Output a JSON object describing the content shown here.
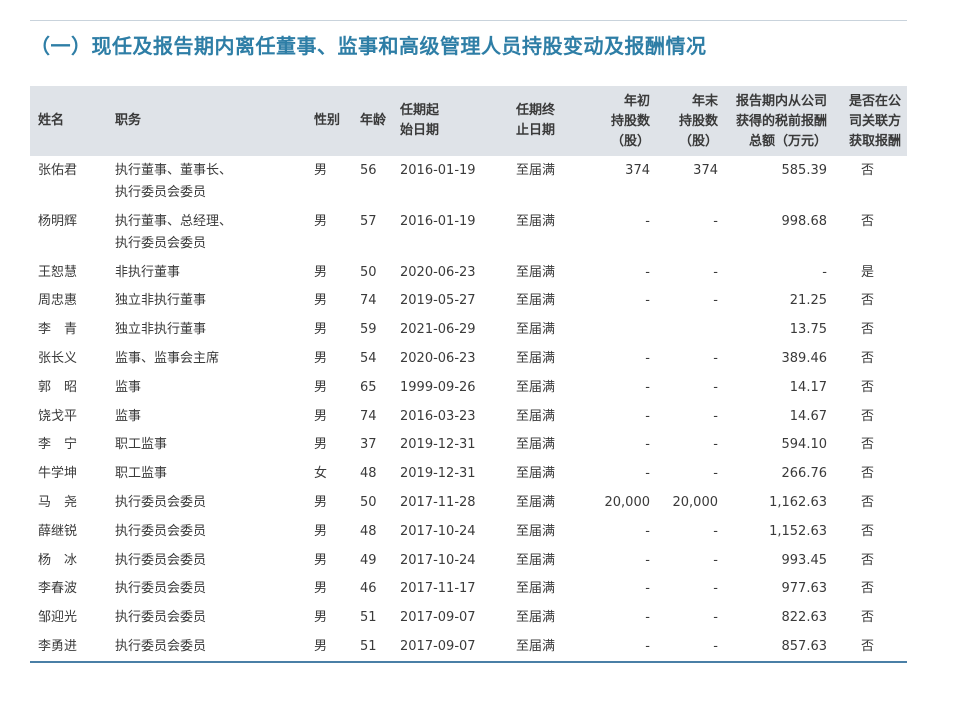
{
  "title": "（一）现任及报告期内离任董事、监事和高级管理人员持股变动及报酬情况",
  "headers": {
    "name": "姓名",
    "position": "职务",
    "gender": "性别",
    "age": "年龄",
    "start": [
      "任期起",
      "始日期"
    ],
    "end": [
      "任期终",
      "止日期"
    ],
    "begin_shares": [
      "年初",
      "持股数",
      "（股）"
    ],
    "end_shares": [
      "年末",
      "持股数",
      "（股）"
    ],
    "pay": [
      "报告期内从公司",
      "获得的税前报酬",
      "总额（万元）"
    ],
    "related": [
      "是否在公",
      "司关联方",
      "获取报酬"
    ]
  },
  "rows": [
    {
      "name": "张佑君",
      "position": [
        "执行董事、董事长、",
        "执行委员会委员"
      ],
      "gender": "男",
      "age": "56",
      "start": "2016-01-19",
      "end": "至届满",
      "begin_shares": "374",
      "end_shares": "374",
      "pay": "585.39",
      "related": "否"
    },
    {
      "name": "杨明辉",
      "position": [
        "执行董事、总经理、",
        "执行委员会委员"
      ],
      "gender": "男",
      "age": "57",
      "start": "2016-01-19",
      "end": "至届满",
      "begin_shares": "-",
      "end_shares": "-",
      "pay": "998.68",
      "related": "否"
    },
    {
      "name": "王恕慧",
      "position": [
        "非执行董事"
      ],
      "gender": "男",
      "age": "50",
      "start": "2020-06-23",
      "end": "至届满",
      "begin_shares": "-",
      "end_shares": "-",
      "pay": "-",
      "related": "是"
    },
    {
      "name": "周忠惠",
      "position": [
        "独立非执行董事"
      ],
      "gender": "男",
      "age": "74",
      "start": "2019-05-27",
      "end": "至届满",
      "begin_shares": "-",
      "end_shares": "-",
      "pay": "21.25",
      "related": "否"
    },
    {
      "name": "李　青",
      "position": [
        "独立非执行董事"
      ],
      "gender": "男",
      "age": "59",
      "start": "2021-06-29",
      "end": "至届满",
      "begin_shares": "",
      "end_shares": "",
      "pay": "13.75",
      "related": "否"
    },
    {
      "name": "张长义",
      "position": [
        "监事、监事会主席"
      ],
      "gender": "男",
      "age": "54",
      "start": "2020-06-23",
      "end": "至届满",
      "begin_shares": "-",
      "end_shares": "-",
      "pay": "389.46",
      "related": "否"
    },
    {
      "name": "郭　昭",
      "position": [
        "监事"
      ],
      "gender": "男",
      "age": "65",
      "start": "1999-09-26",
      "end": "至届满",
      "begin_shares": "-",
      "end_shares": "-",
      "pay": "14.17",
      "related": "否"
    },
    {
      "name": "饶戈平",
      "position": [
        "监事"
      ],
      "gender": "男",
      "age": "74",
      "start": "2016-03-23",
      "end": "至届满",
      "begin_shares": "-",
      "end_shares": "-",
      "pay": "14.67",
      "related": "否"
    },
    {
      "name": "李　宁",
      "position": [
        "职工监事"
      ],
      "gender": "男",
      "age": "37",
      "start": "2019-12-31",
      "end": "至届满",
      "begin_shares": "-",
      "end_shares": "-",
      "pay": "594.10",
      "related": "否"
    },
    {
      "name": "牛学坤",
      "position": [
        "职工监事"
      ],
      "gender": "女",
      "age": "48",
      "start": "2019-12-31",
      "end": "至届满",
      "begin_shares": "-",
      "end_shares": "-",
      "pay": "266.76",
      "related": "否"
    },
    {
      "name": "马　尧",
      "position": [
        "执行委员会委员"
      ],
      "gender": "男",
      "age": "50",
      "start": "2017-11-28",
      "end": "至届满",
      "begin_shares": "20,000",
      "end_shares": "20,000",
      "pay": "1,162.63",
      "related": "否"
    },
    {
      "name": "薛继锐",
      "position": [
        "执行委员会委员"
      ],
      "gender": "男",
      "age": "48",
      "start": "2017-10-24",
      "end": "至届满",
      "begin_shares": "-",
      "end_shares": "-",
      "pay": "1,152.63",
      "related": "否"
    },
    {
      "name": "杨　冰",
      "position": [
        "执行委员会委员"
      ],
      "gender": "男",
      "age": "49",
      "start": "2017-10-24",
      "end": "至届满",
      "begin_shares": "-",
      "end_shares": "-",
      "pay": "993.45",
      "related": "否"
    },
    {
      "name": "李春波",
      "position": [
        "执行委员会委员"
      ],
      "gender": "男",
      "age": "46",
      "start": "2017-11-17",
      "end": "至届满",
      "begin_shares": "-",
      "end_shares": "-",
      "pay": "977.63",
      "related": "否"
    },
    {
      "name": "邹迎光",
      "position": [
        "执行委员会委员"
      ],
      "gender": "男",
      "age": "51",
      "start": "2017-09-07",
      "end": "至届满",
      "begin_shares": "-",
      "end_shares": "-",
      "pay": "822.63",
      "related": "否"
    },
    {
      "name": "李勇进",
      "position": [
        "执行委员会委员"
      ],
      "gender": "男",
      "age": "51",
      "start": "2017-09-07",
      "end": "至届满",
      "begin_shares": "-",
      "end_shares": "-",
      "pay": "857.63",
      "related": "否"
    }
  ]
}
